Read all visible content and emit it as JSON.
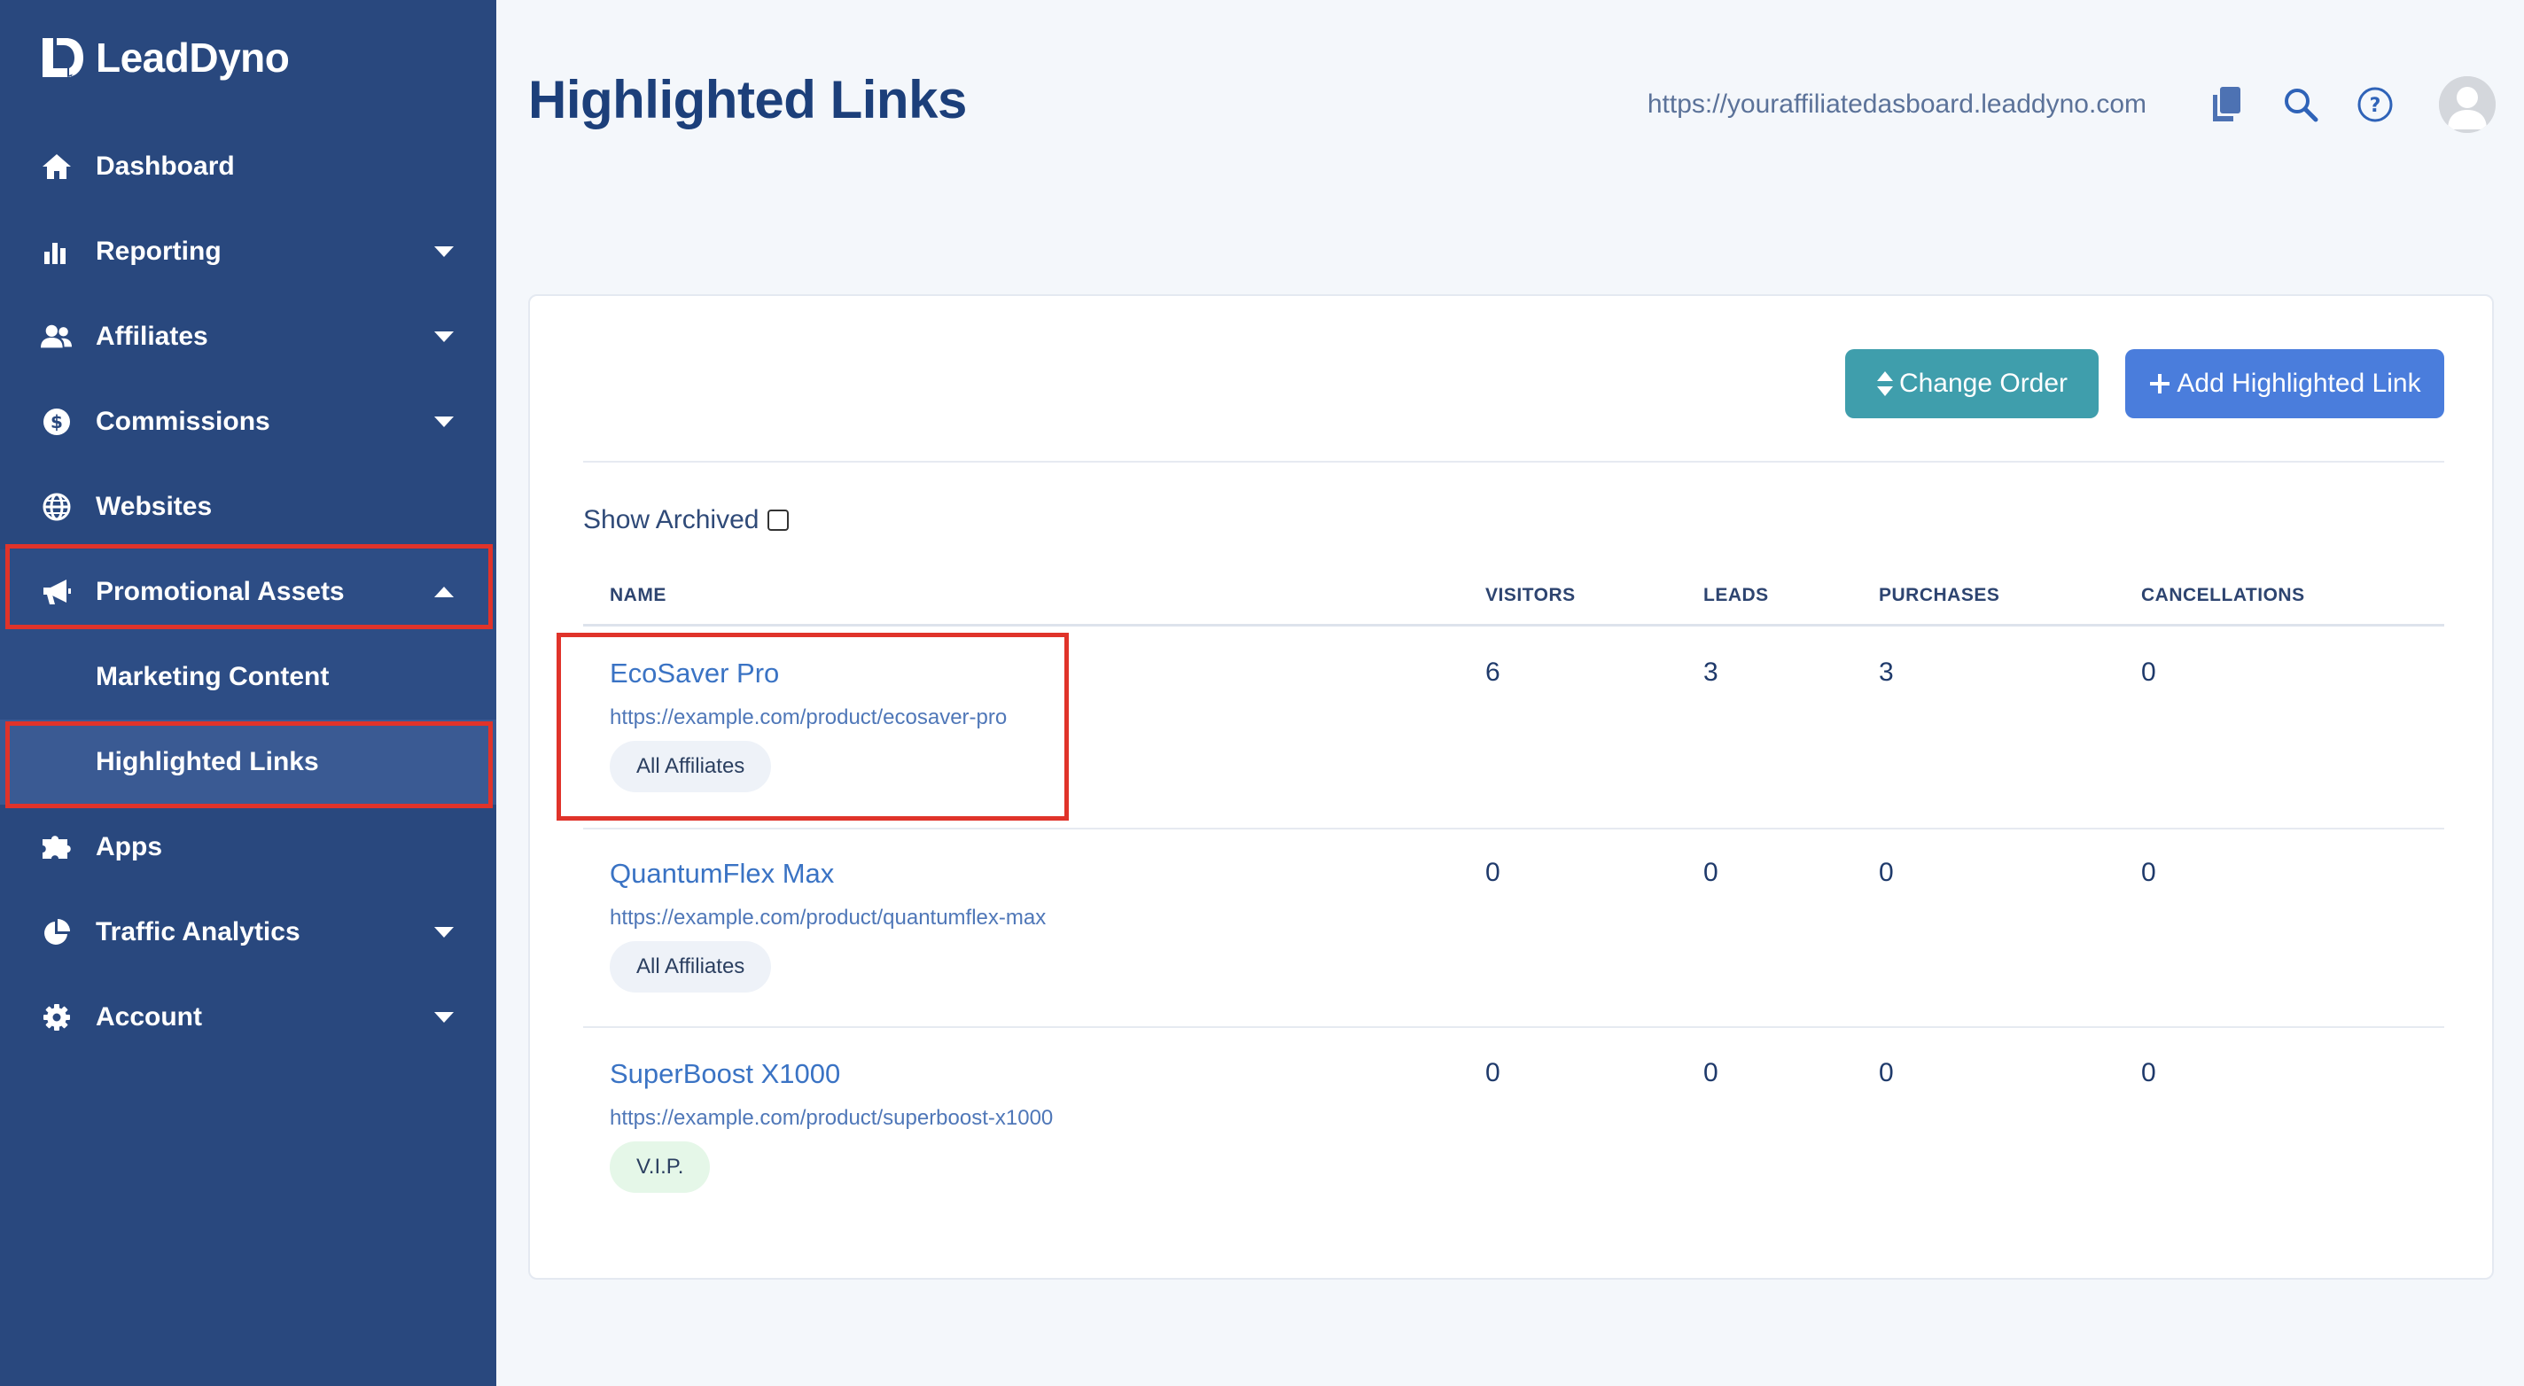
{
  "brand": {
    "name": "LeadDyno"
  },
  "sidebar": {
    "items": [
      {
        "label": "Dashboard",
        "icon": "home-icon"
      },
      {
        "label": "Reporting",
        "icon": "bar-chart-icon"
      },
      {
        "label": "Affiliates",
        "icon": "users-icon"
      },
      {
        "label": "Commissions",
        "icon": "dollar-icon"
      },
      {
        "label": "Websites",
        "icon": "globe-icon"
      },
      {
        "label": "Promotional Assets",
        "icon": "megaphone-icon"
      },
      {
        "label": "Marketing Content"
      },
      {
        "label": "Highlighted Links"
      },
      {
        "label": "Apps",
        "icon": "puzzle-icon"
      },
      {
        "label": "Traffic Analytics",
        "icon": "pie-chart-icon"
      },
      {
        "label": "Account",
        "icon": "gear-icon"
      }
    ]
  },
  "header": {
    "title": "Highlighted Links",
    "dashboard_url": "https://youraffiliatedasboard.leaddyno.com"
  },
  "toolbar": {
    "change_order_label": "Change Order",
    "add_link_label": "Add Highlighted Link"
  },
  "filters": {
    "show_archived_label": "Show Archived"
  },
  "table": {
    "columns": [
      "NAME",
      "VISITORS",
      "LEADS",
      "PURCHASES",
      "CANCELLATIONS"
    ],
    "rows": [
      {
        "name": "EcoSaver Pro",
        "url": "https://example.com/product/ecosaver-pro",
        "group": "All Affiliates",
        "visitors": "6",
        "leads": "3",
        "purchases": "3",
        "cancellations": "0"
      },
      {
        "name": "QuantumFlex Max",
        "url": "https://example.com/product/quantumflex-max",
        "group": "All Affiliates",
        "visitors": "0",
        "leads": "0",
        "purchases": "0",
        "cancellations": "0"
      },
      {
        "name": "SuperBoost X1000",
        "url": "https://example.com/product/superboost-x1000",
        "group": "V.I.P.",
        "visitors": "0",
        "leads": "0",
        "purchases": "0",
        "cancellations": "0"
      }
    ]
  },
  "colors": {
    "sidebar_bg": "#29487e",
    "accent_blue": "#4a7ddc",
    "accent_teal": "#3f9eac",
    "highlight_red": "#e0332a",
    "vip_badge_bg": "#e5f7e8"
  }
}
